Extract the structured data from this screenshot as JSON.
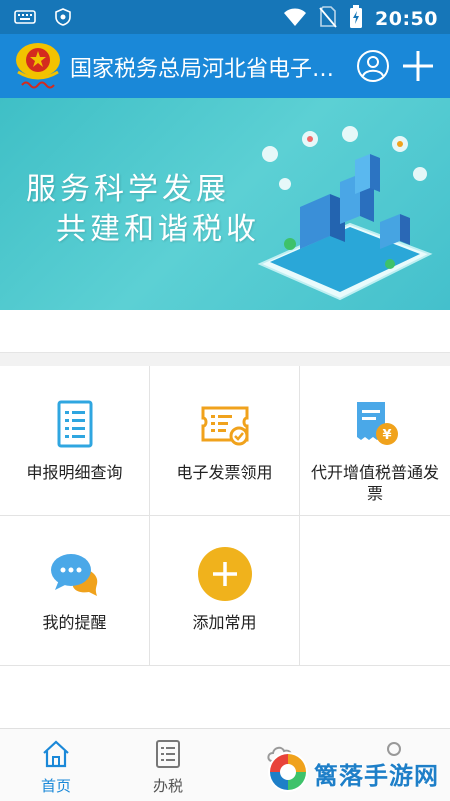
{
  "status_bar": {
    "time": "20:50",
    "icons": [
      "keyboard-icon",
      "shield-icon",
      "wifi-icon",
      "no-sim-icon",
      "battery-charging-icon"
    ]
  },
  "app_bar": {
    "title": "国家税务总局河北省电子税...",
    "actions": [
      "user-icon",
      "plus-icon"
    ]
  },
  "banner": {
    "slogan_line1": "服务科学发展",
    "slogan_line2": "共建和谐税收"
  },
  "services": [
    {
      "label": "申报明细查询",
      "icon": "report-list-icon"
    },
    {
      "label": "电子发票领用",
      "icon": "e-invoice-icon"
    },
    {
      "label": "代开增值税普通发票",
      "icon": "vat-invoice-icon"
    },
    {
      "label": "我的提醒",
      "icon": "reminder-chat-icon"
    },
    {
      "label": "添加常用",
      "icon": "add-circle-icon"
    }
  ],
  "tabs": [
    {
      "label": "首页",
      "icon": "home-icon",
      "active": true
    },
    {
      "label": "办税",
      "icon": "tax-list-icon",
      "active": false
    }
  ],
  "watermark": {
    "text": "篱落手游网"
  },
  "colors": {
    "status_bar": "#1676b8",
    "app_bar": "#1a88d8",
    "banner": "#4cc7cc",
    "accent_blue": "#1a88d8",
    "orange": "#f0a21c",
    "icon_blue": "#2fa6e0"
  }
}
